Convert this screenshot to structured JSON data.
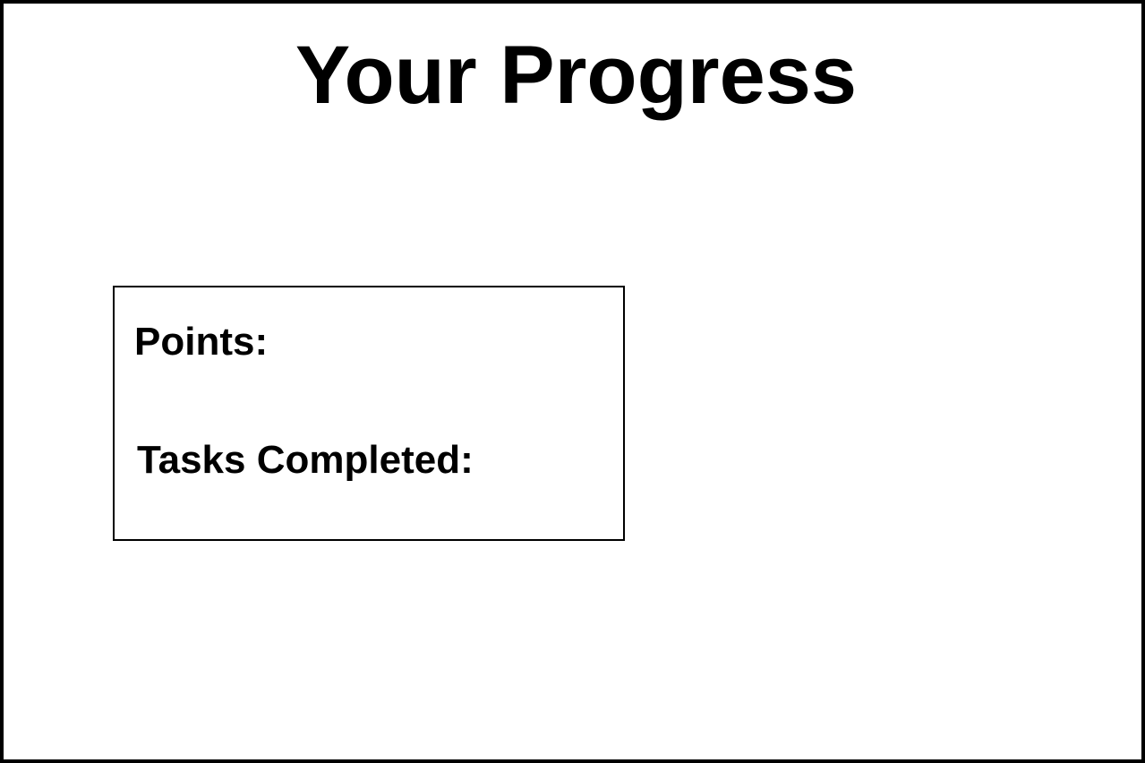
{
  "page": {
    "title": "Your Progress",
    "colors": {
      "background": "#ffffff",
      "border": "#000000",
      "text": "#000000"
    }
  },
  "stats_panel": {
    "points_label": "Points:",
    "tasks_completed_label": "Tasks Completed:"
  }
}
